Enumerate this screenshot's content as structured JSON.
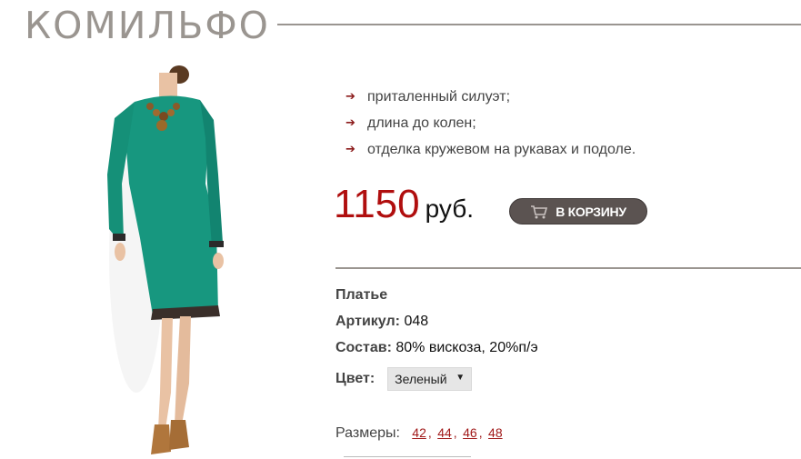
{
  "brand": {
    "title": "КОМИЛЬФО"
  },
  "features": [
    {
      "arrow": "➔",
      "text": "приталенный силуэт;"
    },
    {
      "arrow": "➔",
      "text": "длина до колен;"
    },
    {
      "arrow": "➔",
      "text": "отделка кружевом на рукавах и подоле."
    }
  ],
  "price": {
    "value": "1150",
    "currency": "руб."
  },
  "cart": {
    "label": "В КОРЗИНУ",
    "icon": "cart-icon"
  },
  "details": {
    "product_name": "Платье",
    "article_label": "Артикул:",
    "article_value": "048",
    "composition_label": "Состав:",
    "composition_value": "80% вискоза, 20%п/э",
    "color_label": "Цвет:",
    "color_value": "Зеленый"
  },
  "sizes": {
    "label": "Размеры:",
    "items": [
      "42",
      "44",
      "46",
      "48"
    ]
  },
  "colors": {
    "accent": "#b00e0e",
    "dress": "#1a9b86",
    "button": "#5b5351",
    "rule": "#9a9590"
  }
}
